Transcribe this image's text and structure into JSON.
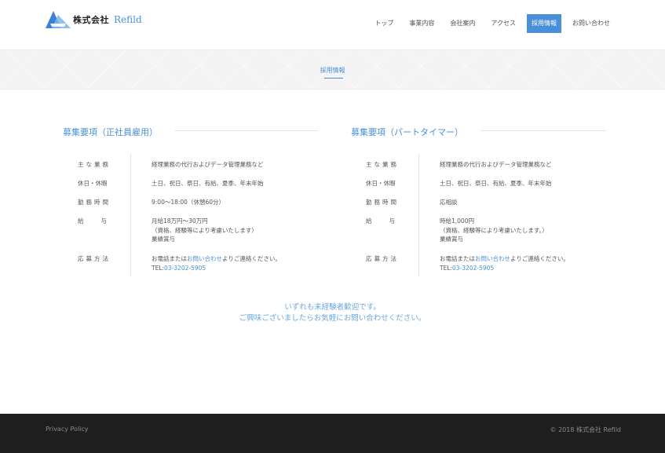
{
  "header": {
    "logo_jp": "株式会社",
    "logo_en": "Refild",
    "nav": [
      {
        "label": "トップ"
      },
      {
        "label": "事業内容"
      },
      {
        "label": "会社案内"
      },
      {
        "label": "アクセス"
      },
      {
        "label": "採用情報"
      },
      {
        "label": "お問い合わせ"
      }
    ],
    "active_nav": "採用情報"
  },
  "band": {
    "title": "採用情報"
  },
  "fulltime": {
    "title": "募集要項（正社員雇用）",
    "rows": [
      {
        "label": "主な業務",
        "lines": [
          "経理業務の代行およびデータ管理業務など"
        ]
      },
      {
        "label": "休日・休暇",
        "lines": [
          "土日、祝日、祭日、有給、夏季、年末年始"
        ]
      },
      {
        "label": "勤務時間",
        "lines": [
          "9:00〜18:00（休憩60分）"
        ]
      },
      {
        "label": "給与",
        "lines": [
          "月給18万円〜30万円",
          "（資格、経験等により考慮いたします）",
          "業績賞与"
        ]
      },
      {
        "label": "応募方法",
        "contact_pre": "お電話または",
        "contact_link": "お問い合わせ",
        "contact_post": "よりご連絡ください。",
        "tel_pre": "TEL:",
        "tel": "03-3202-5905"
      }
    ]
  },
  "parttime": {
    "title": "募集要項（パートタイマー）",
    "rows": [
      {
        "label": "主な業務",
        "lines": [
          "経理業務の代行およびデータ管理業務など"
        ]
      },
      {
        "label": "休日・休暇",
        "lines": [
          "土日、祝日、祭日、有給、夏季、年末年始"
        ]
      },
      {
        "label": "勤務時間",
        "lines": [
          "応相談"
        ]
      },
      {
        "label": "給与",
        "lines": [
          "時給1,000円",
          "（資格、経験等により考慮いたします。）",
          "業績賞与"
        ]
      },
      {
        "label": "応募方法",
        "contact_pre": "お電話または",
        "contact_link": "お問い合わせ",
        "contact_post": "よりご連絡ください。",
        "tel_pre": "TEL:",
        "tel": "03-3202-5905"
      }
    ]
  },
  "message": {
    "line1": "いずれも未経験者歓迎です。",
    "line2": "ご興味ございましたらお気軽にお問い合わせください。"
  },
  "footer": {
    "privacy": "Privacy Policy",
    "copyright": "© 2018 株式会社 Refild"
  },
  "colors": {
    "accent": "#4a90d9",
    "footer_bg": "#1e1e1e"
  }
}
